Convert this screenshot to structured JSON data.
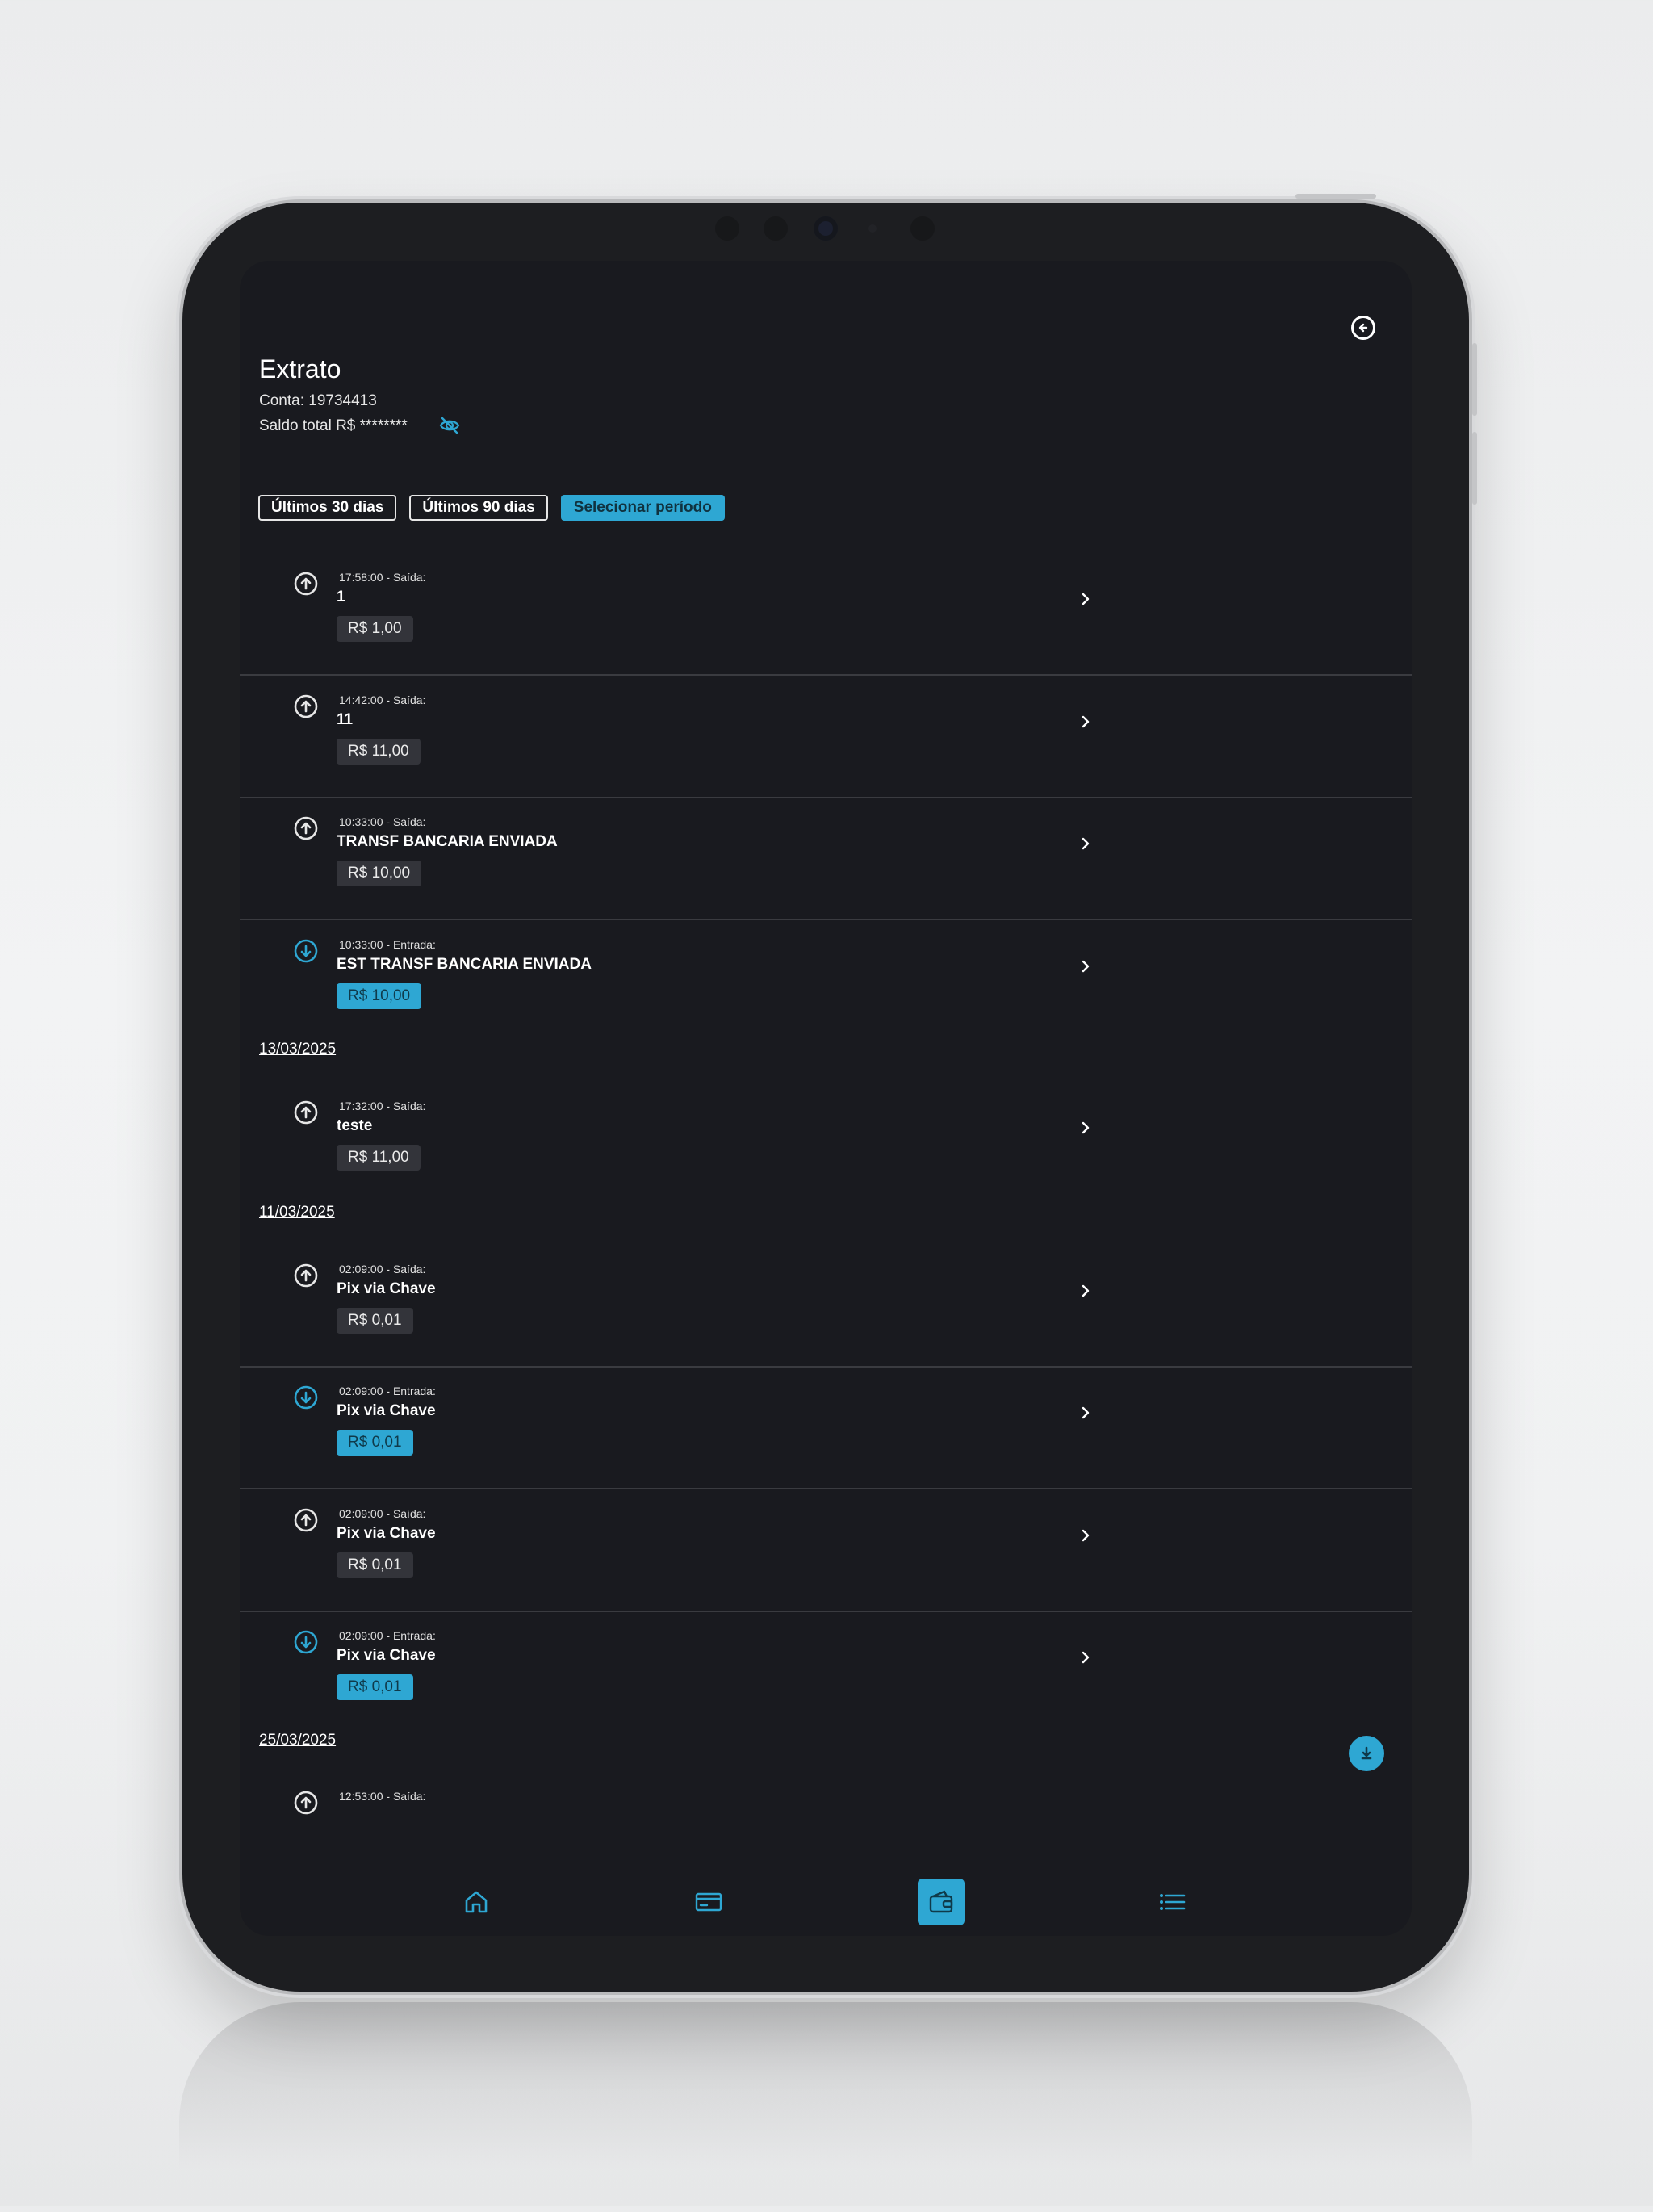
{
  "header": {
    "title": "Extrato",
    "account": "Conta: 19734413",
    "balance": "Saldo total R$ ********"
  },
  "filters": [
    {
      "label": "Últimos 30 dias",
      "active": false
    },
    {
      "label": "Últimos 90 dias",
      "active": false
    },
    {
      "label": "Selecionar período",
      "active": true
    }
  ],
  "groups": [
    {
      "date": "",
      "transactions": [
        {
          "time": "17:58:00 - Saída:",
          "description": "1",
          "amount": "R$ 1,00",
          "direction": "out",
          "icon": "arrow-up-circle-icon"
        },
        {
          "time": "14:42:00 - Saída:",
          "description": "11",
          "amount": "R$ 11,00",
          "direction": "out",
          "icon": "arrow-up-circle-icon"
        },
        {
          "time": "10:33:00 - Saída:",
          "description": "TRANSF BANCARIA ENVIADA",
          "amount": "R$ 10,00",
          "direction": "out",
          "icon": "arrow-up-circle-icon"
        },
        {
          "time": "10:33:00 - Entrada:",
          "description": "EST TRANSF BANCARIA ENVIADA",
          "amount": "R$ 10,00",
          "direction": "in",
          "icon": "arrow-down-circle-icon"
        }
      ]
    },
    {
      "date": "13/03/2025",
      "transactions": [
        {
          "time": "17:32:00 - Saída:",
          "description": "teste",
          "amount": "R$ 11,00",
          "direction": "out",
          "icon": "arrow-up-circle-icon"
        }
      ]
    },
    {
      "date": "11/03/2025",
      "transactions": [
        {
          "time": "02:09:00 - Saída:",
          "description": "Pix via Chave",
          "amount": "R$ 0,01",
          "direction": "out",
          "icon": "arrow-up-circle-icon"
        },
        {
          "time": "02:09:00 - Entrada:",
          "description": "Pix via Chave",
          "amount": "R$ 0,01",
          "direction": "in",
          "icon": "arrow-down-circle-icon"
        },
        {
          "time": "02:09:00 - Saída:",
          "description": "Pix via Chave",
          "amount": "R$ 0,01",
          "direction": "out",
          "icon": "arrow-up-circle-icon"
        },
        {
          "time": "02:09:00 - Entrada:",
          "description": "Pix via Chave",
          "amount": "R$ 0,01",
          "direction": "in",
          "icon": "arrow-down-circle-icon"
        }
      ]
    },
    {
      "date": "25/03/2025",
      "transactions": [
        {
          "time": "12:53:00 - Saída:",
          "description": "",
          "amount": "",
          "direction": "out",
          "icon": "arrow-up-circle-icon"
        }
      ]
    }
  ],
  "bottom_nav": [
    {
      "name": "home",
      "icon": "home-icon",
      "active": false
    },
    {
      "name": "card",
      "icon": "credit-card-icon",
      "active": false
    },
    {
      "name": "wallet",
      "icon": "wallet-icon",
      "active": true
    },
    {
      "name": "menu",
      "icon": "list-icon",
      "active": false
    }
  ],
  "colors": {
    "accent": "#2ea7d3",
    "background": "#191a1f",
    "amount_out_bg": "#33343a",
    "divider": "#3a3b40"
  }
}
